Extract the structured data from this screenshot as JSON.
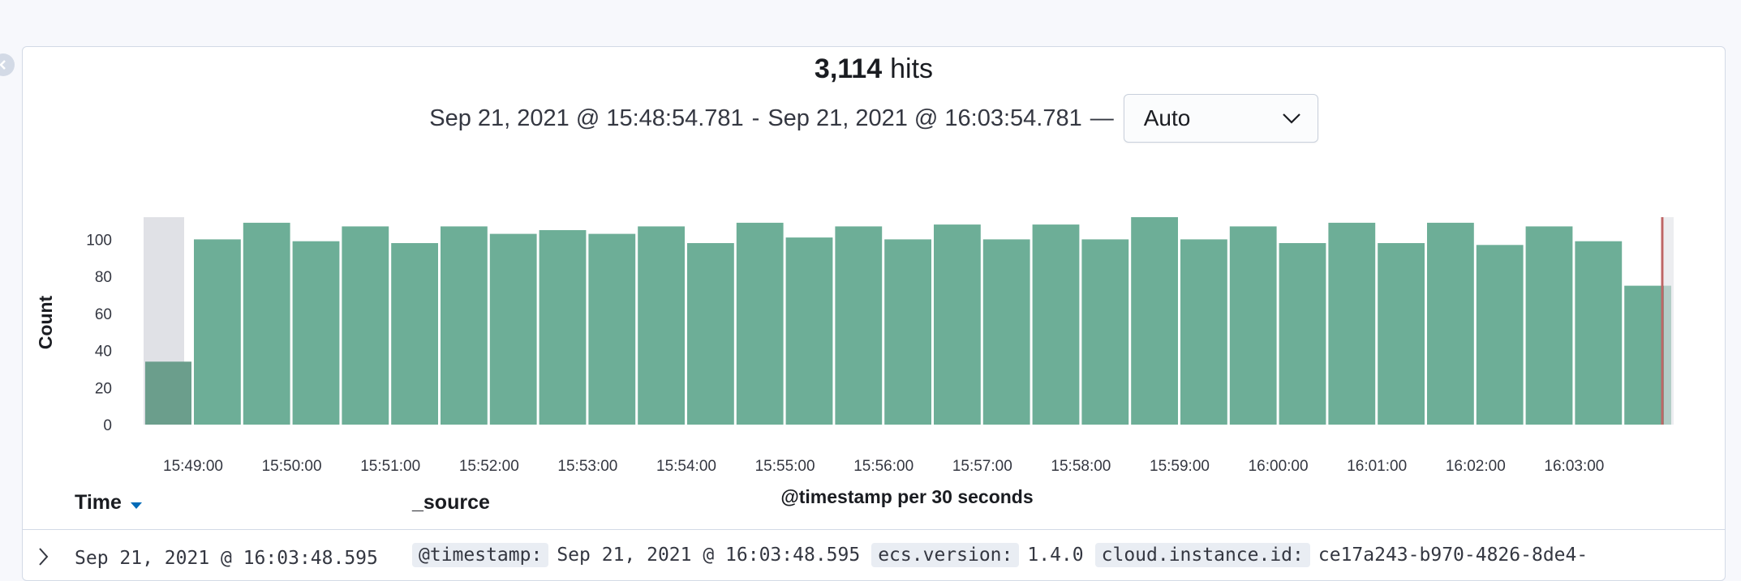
{
  "hits": {
    "count": "3,114",
    "label": "hits"
  },
  "time_range": {
    "from": "Sep 21, 2021 @ 15:48:54.781",
    "separator": "-",
    "to": "Sep 21, 2021 @ 16:03:54.781",
    "dash": "—"
  },
  "interval": {
    "selected": "Auto"
  },
  "chart_data": {
    "type": "bar",
    "title": "",
    "xlabel": "@timestamp per 30 seconds",
    "ylabel": "Count",
    "ylim": [
      0,
      112
    ],
    "y_ticks": [
      "0",
      "20",
      "40",
      "60",
      "80",
      "100"
    ],
    "x_tick_labels": [
      "15:49:00",
      "15:50:00",
      "15:51:00",
      "15:52:00",
      "15:53:00",
      "15:54:00",
      "15:55:00",
      "15:56:00",
      "15:57:00",
      "15:58:00",
      "15:59:00",
      "16:00:00",
      "16:01:00",
      "16:02:00",
      "16:03:00"
    ],
    "values": [
      34,
      100,
      109,
      99,
      107,
      98,
      107,
      103,
      105,
      103,
      107,
      98,
      109,
      101,
      107,
      100,
      108,
      100,
      108,
      100,
      112,
      100,
      107,
      98,
      109,
      98,
      109,
      97,
      107,
      99,
      75
    ],
    "bar_color": "#6dae97",
    "partial_bucket_color": "#e0e1e6",
    "now_marker_color": "#bd6666",
    "grid": false
  },
  "table": {
    "columns": {
      "time": "Time",
      "source": "_source"
    },
    "rows": [
      {
        "time": "Sep 21, 2021 @ 16:03:48.595",
        "fields": [
          {
            "key": "@timestamp:",
            "value": "Sep 21, 2021 @ 16:03:48.595"
          },
          {
            "key": "ecs.version:",
            "value": "1.4.0"
          },
          {
            "key": "cloud.instance.id:",
            "value": "ce17a243-b970-4826-8de4-"
          }
        ]
      }
    ]
  },
  "icons": {
    "collapse": "arrow-left-icon",
    "dropdown": "chevron-down-icon",
    "sort": "sort-down-icon",
    "expand": "chevron-right-icon"
  }
}
